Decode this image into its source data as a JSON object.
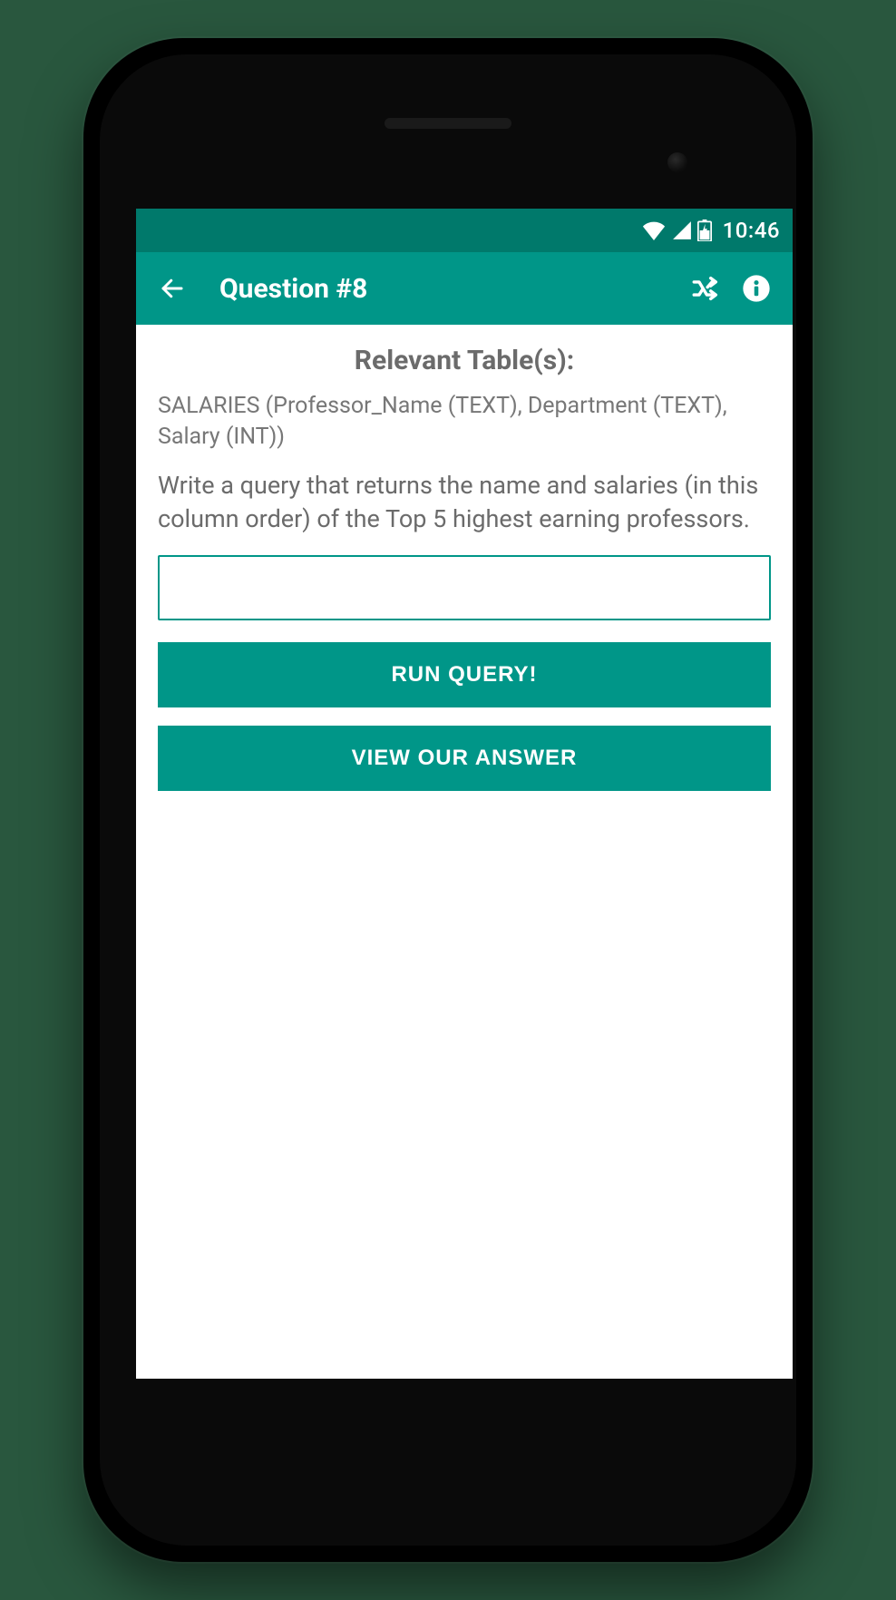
{
  "status_bar": {
    "time": "10:46"
  },
  "app_bar": {
    "title": "Question #8"
  },
  "content": {
    "section_title": "Relevant Table(s):",
    "schema": "SALARIES (Professor_Name (TEXT), Department (TEXT), Salary (INT))",
    "prompt": "Write a query that returns the name and salaries (in this column order) of the Top 5 highest earning professors.",
    "query_value": "",
    "run_label": "RUN QUERY!",
    "view_answer_label": "VIEW OUR ANSWER"
  }
}
